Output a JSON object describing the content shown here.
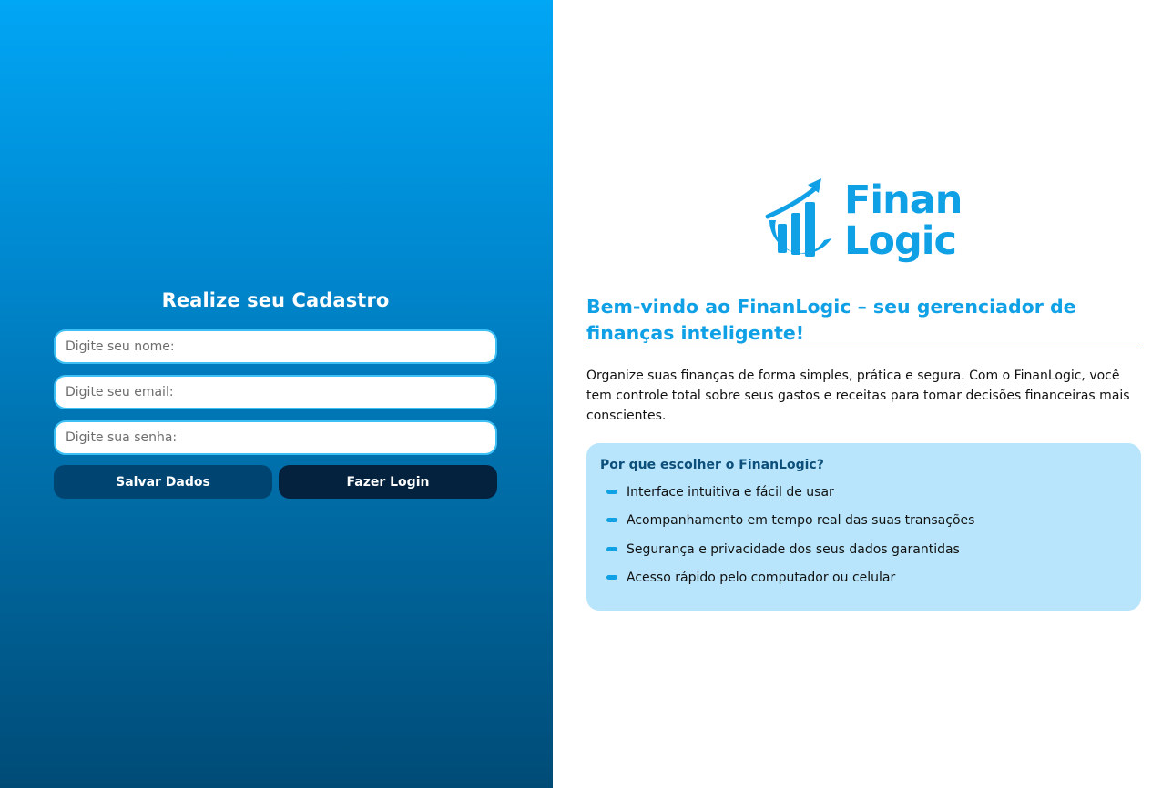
{
  "form": {
    "title": "Realize seu Cadastro",
    "name_placeholder": "Digite seu nome:",
    "email_placeholder": "Digite seu email:",
    "password_placeholder": "Digite sua senha:",
    "save_label": "Salvar Dados",
    "login_label": "Fazer Login"
  },
  "brand": {
    "line1": "Finan",
    "line2": "Logic",
    "logo_icon": "chart-growth-icon",
    "color": "#0fa0e6"
  },
  "welcome": {
    "headline": "Bem-vindo ao FinanLogic – seu gerenciador de finanças inteligente!",
    "intro": "Organize suas finanças de forma simples, prática e segura. Com o FinanLogic, você tem controle total sobre seus gastos e receitas para tomar decisões financeiras mais conscientes."
  },
  "why": {
    "title": "Por que escolher o FinanLogic?",
    "items": [
      "Interface intuitiva e fácil de usar",
      "Acompanhamento em tempo real das suas transações",
      "Segurança e privacidade dos seus dados garantidas",
      "Acesso rápido pelo computador ou celular"
    ]
  },
  "colors": {
    "gradient_top": "#01a6f5",
    "gradient_bottom": "#004b76",
    "save_button": "#004572",
    "login_button": "#04223d",
    "card_bg": "#b8e5fb"
  }
}
